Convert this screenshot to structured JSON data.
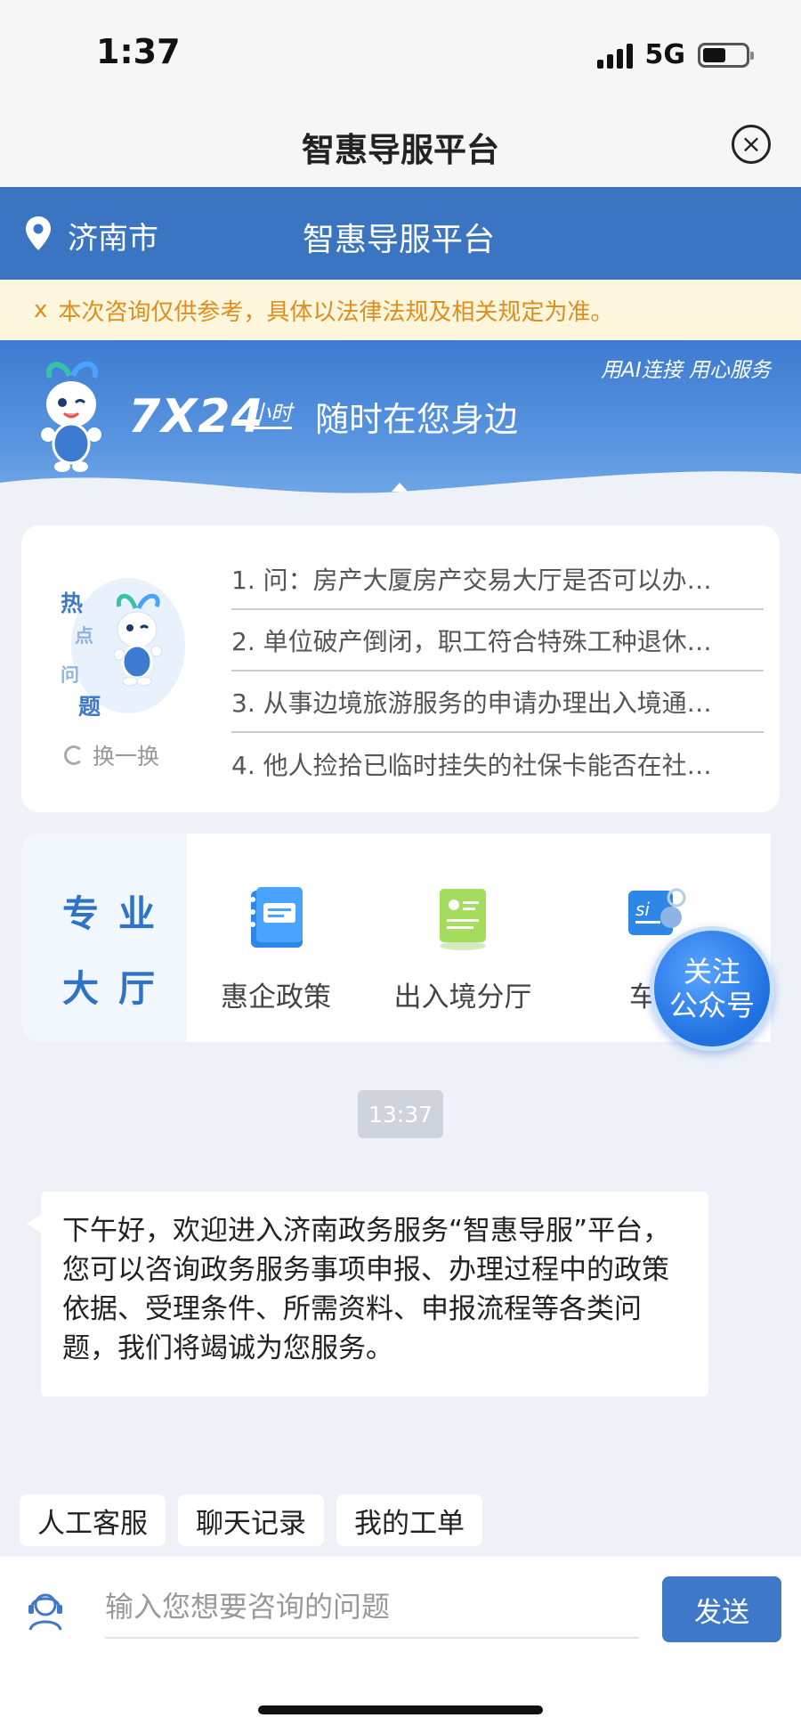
{
  "status_bar": {
    "time": "1:37",
    "network": "5G"
  },
  "title_bar": {
    "title": "智惠导服平台",
    "close_glyph": "×"
  },
  "city_bar": {
    "city": "济南市",
    "title": "智惠导服平台"
  },
  "notice": {
    "close_glyph": "x",
    "text": "本次咨询仅供参考，具体以法律法规及相关规定为准。"
  },
  "banner": {
    "big_text": "7X24",
    "hours_text": "小时",
    "slogan": "随时在您身边",
    "tagline": "用AI连接 用心服务"
  },
  "hot_questions": {
    "badge_chars": [
      "热",
      "点",
      "问",
      "题"
    ],
    "refresh_label": "换一换",
    "items": [
      "1. 问：房产大厦房产交易大厅是否可以办…",
      "2. 单位破产倒闭，职工符合特殊工种退休…",
      "3. 从事边境旅游服务的申请办理出入境通…",
      "4. 他人捡拾已临时挂失的社保卡能否在社…"
    ]
  },
  "halls": {
    "label_line1": "专业",
    "label_line2": "大厅",
    "items": [
      {
        "label": "惠企政策",
        "icon": "notebook-icon"
      },
      {
        "label": "出入境分厅",
        "icon": "id-card-icon"
      },
      {
        "label": "车辆",
        "icon": "si-gear-icon"
      }
    ]
  },
  "follow_button": {
    "line1": "关注",
    "line2": "公众号"
  },
  "chat": {
    "time": "13:37",
    "welcome": "下午好，欢迎进入济南政务服务“智惠导服”平台，您可以咨询政务服务事项申报、办理过程中的政策依据、受理条件、所需资料、申报流程等各类问题，我们将竭诚为您服务。"
  },
  "quick_actions": [
    "人工客服",
    "聊天记录",
    "我的工单"
  ],
  "input": {
    "placeholder": "输入您想要咨询的问题",
    "value": "",
    "send_label": "发送"
  },
  "colors": {
    "primary": "#3b74c0",
    "notice_text": "#e08c1e",
    "notice_bg": "#fbf6dc",
    "page_bg": "#eef2f8"
  }
}
